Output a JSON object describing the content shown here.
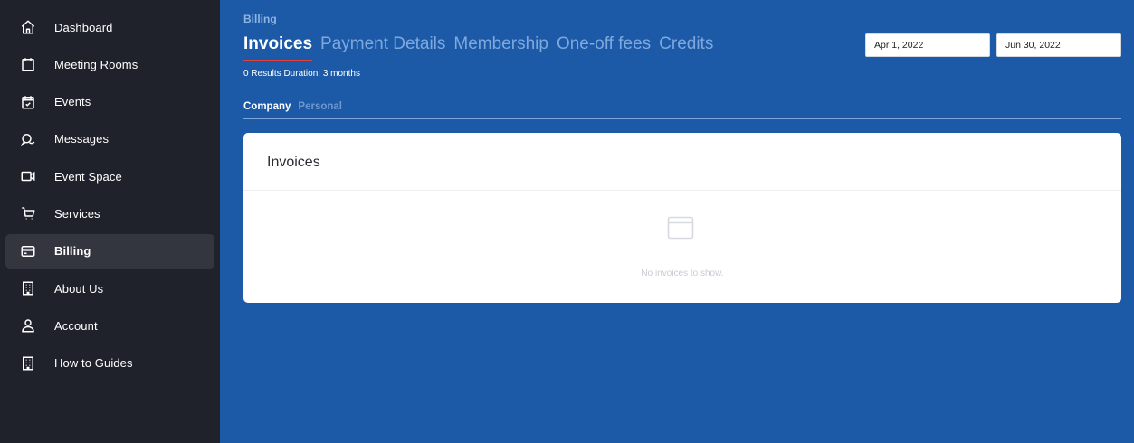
{
  "sidebar": {
    "items": [
      {
        "label": "Dashboard",
        "icon": "home-icon"
      },
      {
        "label": "Meeting Rooms",
        "icon": "calendar-icon"
      },
      {
        "label": "Events",
        "icon": "calendar-check-icon"
      },
      {
        "label": "Messages",
        "icon": "chat-bubbles-icon"
      },
      {
        "label": "Event Space",
        "icon": "video-camera-icon"
      },
      {
        "label": "Services",
        "icon": "cart-icon"
      },
      {
        "label": "Billing",
        "icon": "credit-card-icon",
        "active": true
      },
      {
        "label": "About Us",
        "icon": "building-icon"
      },
      {
        "label": "Account",
        "icon": "user-icon"
      },
      {
        "label": "How to Guides",
        "icon": "building-icon"
      }
    ]
  },
  "header": {
    "breadcrumb": "Billing",
    "tabs": [
      {
        "label": "Invoices",
        "active": true
      },
      {
        "label": "Payment Details"
      },
      {
        "label": "Membership"
      },
      {
        "label": "One-off fees"
      },
      {
        "label": "Credits"
      }
    ],
    "results": "0 Results  Duration: 3 months",
    "date_start": "Apr 1, 2022",
    "date_end": "Jun 30, 2022"
  },
  "subtabs": [
    {
      "label": "Company",
      "active": true
    },
    {
      "label": "Personal"
    }
  ],
  "card": {
    "title": "Invoices",
    "empty_icon": "empty-window-icon",
    "empty_text": "No invoices to show."
  },
  "colors": {
    "sidebar_bg": "#1f212b",
    "main_bg": "#1c5aa8",
    "active_tab_underline": "#e0413b"
  }
}
